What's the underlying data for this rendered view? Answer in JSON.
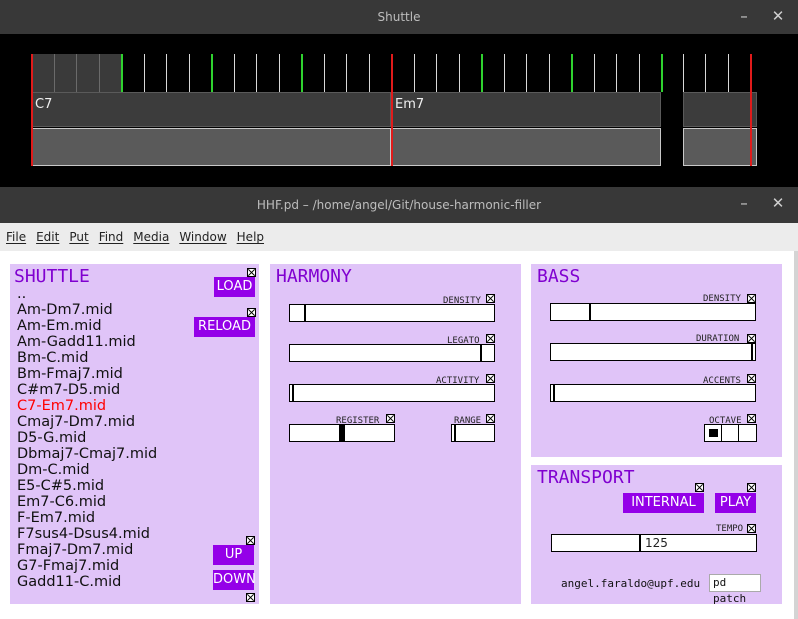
{
  "shuttle_window": {
    "title": "Shuttle",
    "minimize_glyph": "–",
    "close_glyph": "✕",
    "chord_labels": [
      "C7",
      "Em7"
    ]
  },
  "hhf_window": {
    "title": "HHF.pd  – /home/angel/Git/house-harmonic-filler",
    "minimize_glyph": "–",
    "close_glyph": "✕",
    "menu": [
      "File",
      "Edit",
      "Put",
      "Find",
      "Media",
      "Window",
      "Help"
    ]
  },
  "shuttle_panel": {
    "title": "SHUTTLE",
    "load_label": "LOAD",
    "reload_label": "RELOAD",
    "up_label": "UP",
    "down_label": "DOWN",
    "files": [
      "..",
      "Am-Dm7.mid",
      "Am-Em.mid",
      "Am-Gadd11.mid",
      "Bm-C.mid",
      "Bm-Fmaj7.mid",
      "C#m7-D5.mid",
      "C7-Em7.mid",
      "Cmaj7-Dm7.mid",
      "D5-G.mid",
      "Dbmaj7-Cmaj7.mid",
      "Dm-C.mid",
      "E5-C#5.mid",
      "Em7-C6.mid",
      "F-Em7.mid",
      "F7sus4-Dsus4.mid",
      "Fmaj7-Dm7.mid",
      "G7-Fmaj7.mid",
      "Gadd11-C.mid"
    ],
    "selected_file": "C7-Em7.mid"
  },
  "harmony_panel": {
    "title": "HARMONY",
    "density_label": "DENSITY",
    "density_value": 0.07,
    "legato_label": "LEGATO",
    "legato_value": 0.94,
    "activity_label": "ACTIVITY",
    "activity_value": 0.01,
    "register_label": "REGISTER",
    "register_value": 0.5,
    "range_label": "RANGE",
    "range_value": 0.05
  },
  "bass_panel": {
    "title": "BASS",
    "density_label": "DENSITY",
    "density_value": 0.19,
    "duration_label": "DURATION",
    "duration_value": 0.99,
    "accents_label": "ACCENTS",
    "accents_value": 0.01,
    "octave_label": "OCTAVE",
    "octave_selected": 0,
    "octave_options": 3
  },
  "transport_panel": {
    "title": "TRANSPORT",
    "internal_label": "INTERNAL",
    "play_label": "PLAY",
    "tempo_label": "TEMPO",
    "tempo_value": "125",
    "tempo_fraction": 0.43,
    "email": "angel.faraldo@upf.edu",
    "pd_patch_label": "pd patch"
  },
  "colors": {
    "panel": "#e0c4f8",
    "title_text": "#8000d0",
    "button": "#9400e8",
    "selected_file": "#ff0000",
    "beat_accent": "#2fd22f",
    "bar_marker": "#e01b1b"
  }
}
